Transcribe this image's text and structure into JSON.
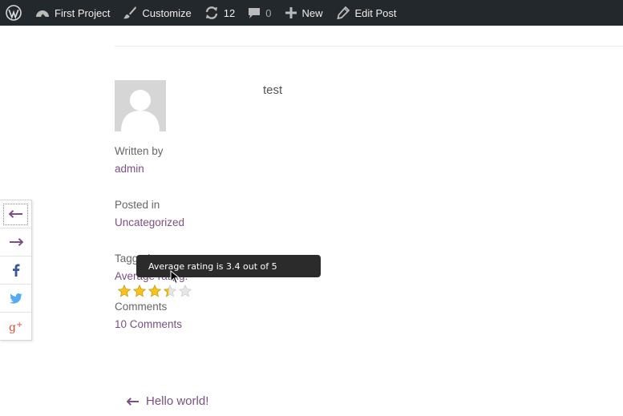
{
  "adminbar": {
    "site_name": "First Project",
    "customize": "Customize",
    "updates_count": "12",
    "comments_count": "0",
    "new_label": "New",
    "edit_post": "Edit Post"
  },
  "post": {
    "content": "test"
  },
  "meta": {
    "written_by_label": "Written by",
    "author": "admin",
    "posted_in_label": "Posted in",
    "category": "Uncategorized",
    "tagged_label": "Tagged",
    "average_rating_label": "Average rating:",
    "comments_label": "Comments",
    "comments_link": "10 Comments"
  },
  "rating": {
    "tooltip": "Average rating is 3.4 out of 5",
    "value": 3.4,
    "max": 5,
    "filled_color": "#f6c21b",
    "empty_color": "#e6e6e6"
  },
  "share": {
    "items": [
      "previous-icon",
      "next-icon",
      "facebook-icon",
      "twitter-icon",
      "google-plus-icon"
    ]
  },
  "navigation": {
    "previous_post": "Hello world!"
  },
  "colors": {
    "adminbar_bg": "#23282d",
    "link": "#7b4f84",
    "facebook": "#3b5998",
    "twitter": "#55acee",
    "googleplus": "#dd4b39"
  }
}
